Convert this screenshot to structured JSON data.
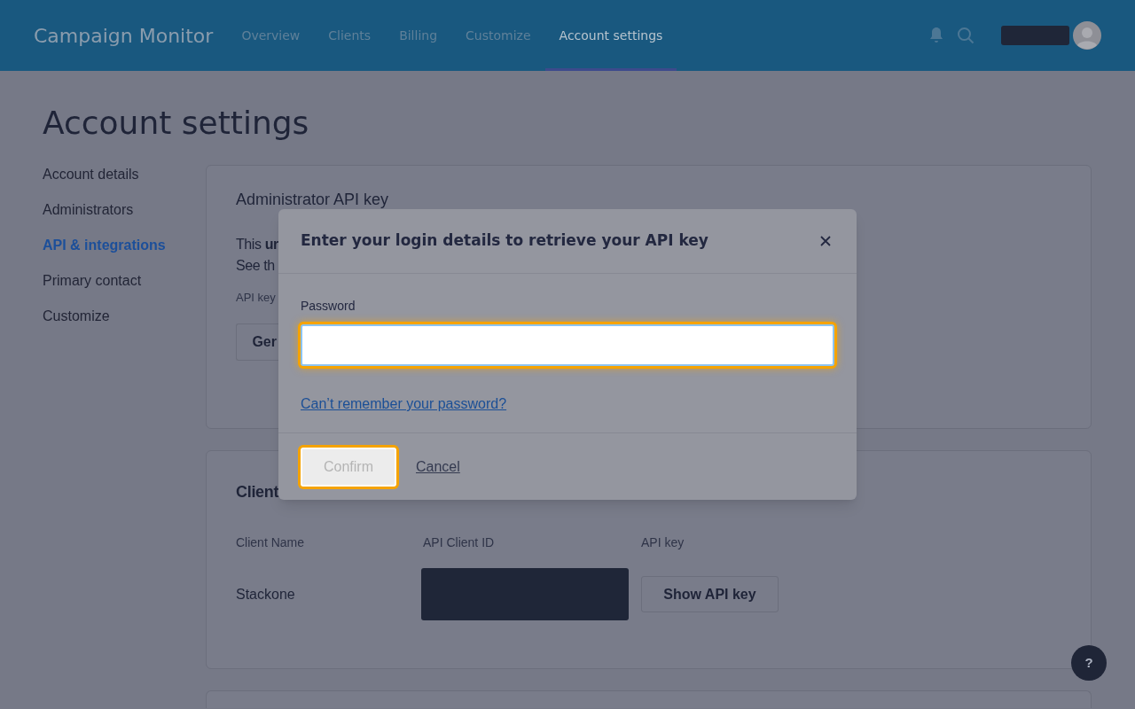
{
  "header": {
    "logo": "Campaign Monitor",
    "nav": [
      {
        "label": "Overview",
        "selected": false
      },
      {
        "label": "Clients",
        "selected": false
      },
      {
        "label": "Billing",
        "selected": false
      },
      {
        "label": "Customize",
        "selected": false
      },
      {
        "label": "Account settings",
        "selected": true
      }
    ]
  },
  "page_title": "Account settings",
  "sidebar": [
    {
      "label": "Account details",
      "selected": false
    },
    {
      "label": "Administrators",
      "selected": false
    },
    {
      "label": "API & integrations",
      "selected": true
    },
    {
      "label": "Primary contact",
      "selected": false
    },
    {
      "label": "Customize",
      "selected": false
    }
  ],
  "admin_card": {
    "title": "Administrator API key",
    "lines": [
      "This **ur**",
      "See th"
    ],
    "field_label": "API key",
    "button": "Ger"
  },
  "clients_card": {
    "title": "Client",
    "columns": [
      "Client Name",
      "API Client ID",
      "API key"
    ],
    "rows": [
      {
        "name": "Stackone",
        "button": "Show API key"
      }
    ]
  },
  "modal": {
    "title": "Enter your login details to retrieve your API key",
    "password_label": "Password",
    "forgot_link": "Can’t remember your password?",
    "confirm": {
      "label": "Confirm",
      "disabled": true
    },
    "cancel": "Cancel"
  },
  "help": "?"
}
